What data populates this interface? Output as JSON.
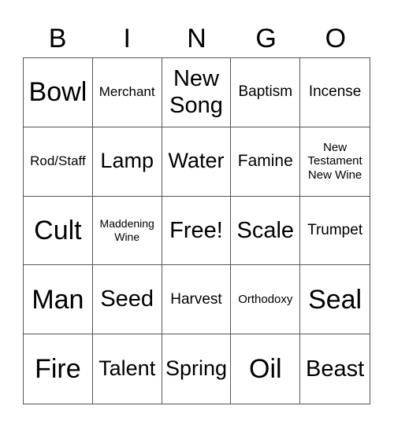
{
  "header": [
    "B",
    "I",
    "N",
    "G",
    "O"
  ],
  "cells": [
    "Bowl",
    "Merchant",
    "New\nSong",
    "Baptism",
    "Incense",
    "Rod/Staff",
    "Lamp",
    "Water",
    "Famine",
    "New\nTestament\nNew Wine",
    "Cult",
    "Maddening\nWine",
    "Free!",
    "Scale",
    "Trumpet",
    "Man",
    "Seed",
    "Harvest",
    "Orthodoxy",
    "Seal",
    "Fire",
    "Talent",
    "Spring",
    "Oil",
    "Beast"
  ]
}
